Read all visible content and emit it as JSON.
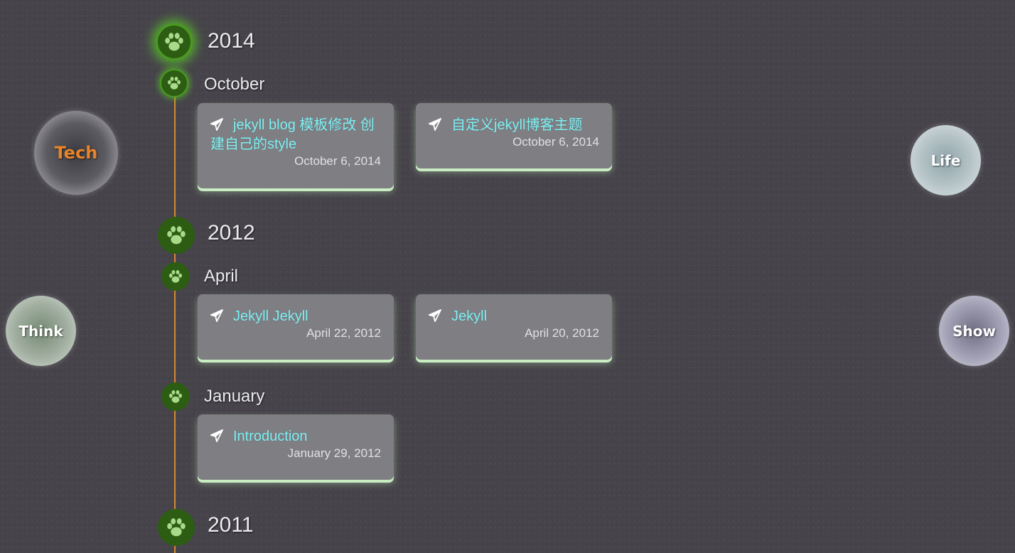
{
  "nav": {
    "tech": {
      "label": "Tech",
      "color": "#e8842a"
    },
    "think": {
      "label": "Think",
      "color": "#ffffff"
    },
    "life": {
      "label": "Life",
      "color": "#ffffff"
    },
    "show": {
      "label": "Show",
      "color": "#ffffff"
    }
  },
  "colors": {
    "line": "#d28a34",
    "node": "#2c5d13",
    "link": "#7ef2f5",
    "card": "#7f7e83"
  },
  "timeline": {
    "y2014": {
      "year": "2014",
      "months": {
        "october": {
          "label": "October",
          "posts": [
            {
              "title": "jekyll blog 模板修改 创建自己的style",
              "date": "October 6, 2014"
            },
            {
              "title": "自定义jekyll博客主题",
              "date": "October 6, 2014"
            }
          ]
        }
      }
    },
    "y2012": {
      "year": "2012",
      "months": {
        "april": {
          "label": "April",
          "posts": [
            {
              "title": "Jekyll Jekyll",
              "date": "April 22, 2012"
            },
            {
              "title": "Jekyll",
              "date": "April 20, 2012"
            }
          ]
        },
        "january": {
          "label": "January",
          "posts": [
            {
              "title": "Introduction",
              "date": "January 29, 2012"
            }
          ]
        }
      }
    },
    "y2011": {
      "year": "2011"
    }
  }
}
